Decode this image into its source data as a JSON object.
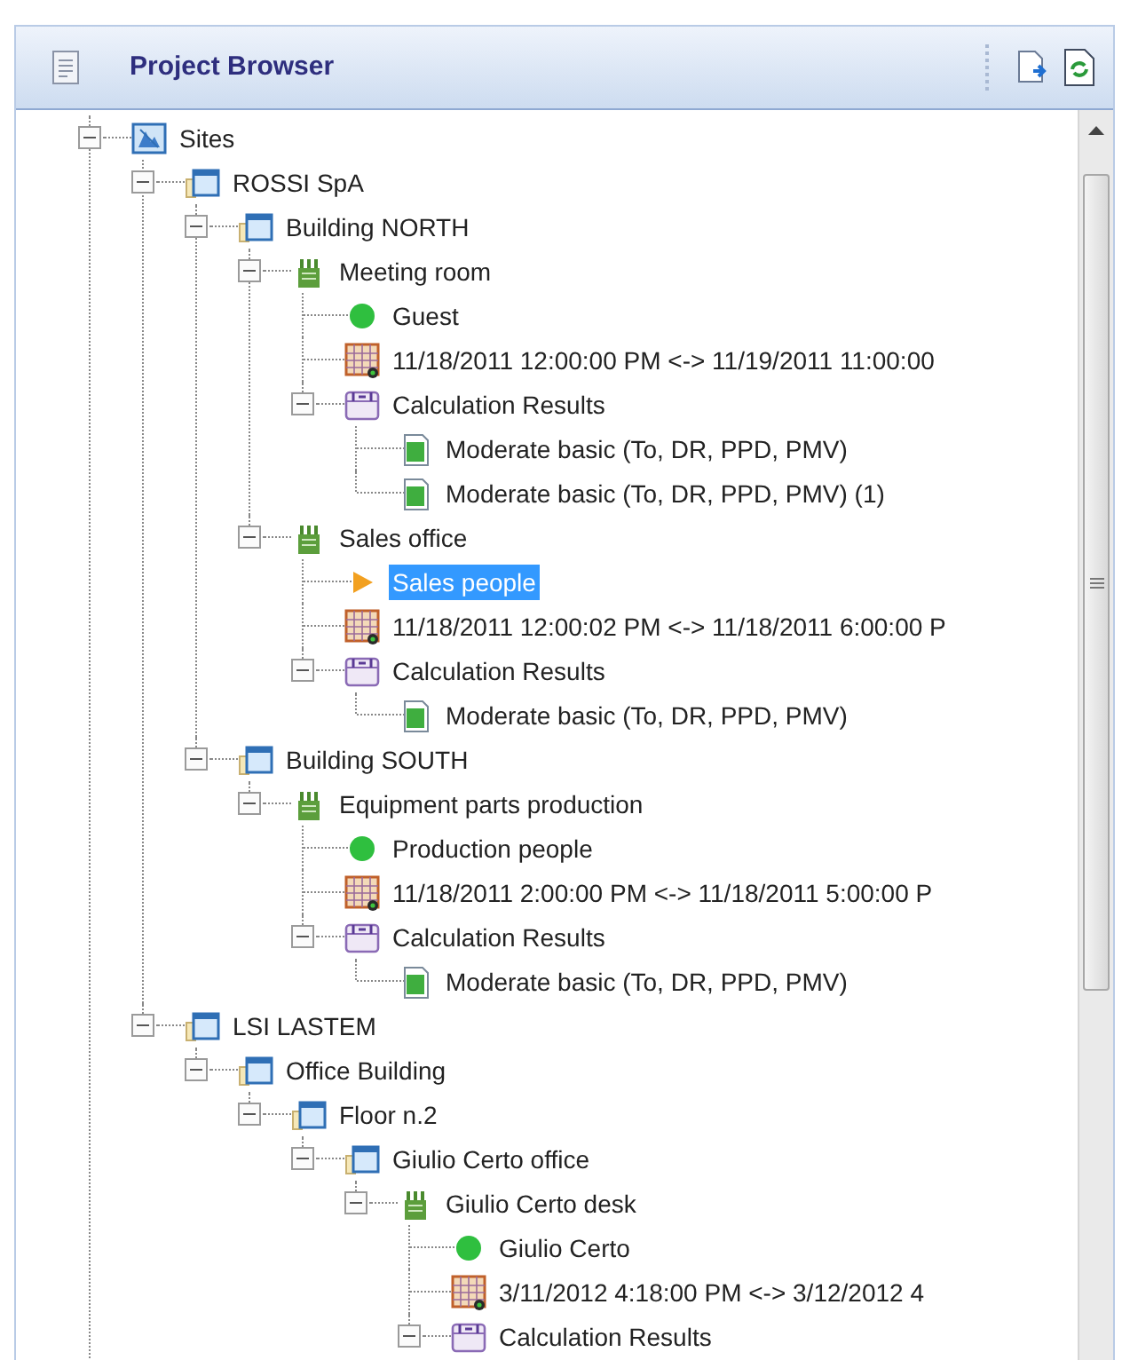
{
  "panel": {
    "title": "Project Browser"
  },
  "tree": [
    {
      "label": "Sites",
      "kind": "sites",
      "expanded": true,
      "selected": false,
      "children": [
        {
          "label": "ROSSI SpA",
          "kind": "site",
          "expanded": true,
          "selected": false,
          "children": [
            {
              "label": "Building NORTH",
              "kind": "site",
              "expanded": true,
              "selected": false,
              "children": [
                {
                  "label": "Meeting room",
                  "kind": "room",
                  "expanded": true,
                  "selected": false,
                  "children": [
                    {
                      "label": "Guest",
                      "kind": "occupant",
                      "selected": false
                    },
                    {
                      "label": "11/18/2011 12:00:00 PM <-> 11/19/2011 11:00:00",
                      "kind": "schedule",
                      "selected": false
                    },
                    {
                      "label": "Calculation Results",
                      "kind": "results",
                      "expanded": true,
                      "selected": false,
                      "children": [
                        {
                          "label": "Moderate basic (To, DR, PPD, PMV)",
                          "kind": "report",
                          "selected": false
                        },
                        {
                          "label": "Moderate basic (To, DR, PPD, PMV) (1)",
                          "kind": "report",
                          "selected": false
                        }
                      ]
                    }
                  ]
                },
                {
                  "label": "Sales office",
                  "kind": "room",
                  "expanded": true,
                  "selected": false,
                  "children": [
                    {
                      "label": "Sales people",
                      "kind": "occupant-active",
                      "selected": true
                    },
                    {
                      "label": "11/18/2011 12:00:02 PM <-> 11/18/2011 6:00:00 P",
                      "kind": "schedule",
                      "selected": false
                    },
                    {
                      "label": "Calculation Results",
                      "kind": "results",
                      "expanded": true,
                      "selected": false,
                      "children": [
                        {
                          "label": "Moderate basic (To, DR, PPD, PMV)",
                          "kind": "report",
                          "selected": false
                        }
                      ]
                    }
                  ]
                }
              ]
            },
            {
              "label": "Building SOUTH",
              "kind": "site",
              "expanded": true,
              "selected": false,
              "children": [
                {
                  "label": "Equipment parts production",
                  "kind": "room",
                  "expanded": true,
                  "selected": false,
                  "children": [
                    {
                      "label": "Production people",
                      "kind": "occupant",
                      "selected": false
                    },
                    {
                      "label": "11/18/2011 2:00:00 PM <-> 11/18/2011 5:00:00 P",
                      "kind": "schedule",
                      "selected": false
                    },
                    {
                      "label": "Calculation Results",
                      "kind": "results",
                      "expanded": true,
                      "selected": false,
                      "children": [
                        {
                          "label": "Moderate basic (To, DR, PPD, PMV)",
                          "kind": "report",
                          "selected": false
                        }
                      ]
                    }
                  ]
                }
              ]
            }
          ]
        },
        {
          "label": "LSI LASTEM",
          "kind": "site",
          "expanded": true,
          "selected": false,
          "children": [
            {
              "label": "Office Building",
              "kind": "site",
              "expanded": true,
              "selected": false,
              "children": [
                {
                  "label": "Floor n.2",
                  "kind": "site",
                  "expanded": true,
                  "selected": false,
                  "children": [
                    {
                      "label": "Giulio Certo office",
                      "kind": "site",
                      "expanded": true,
                      "selected": false,
                      "children": [
                        {
                          "label": "Giulio Certo desk",
                          "kind": "room",
                          "expanded": true,
                          "selected": false,
                          "children": [
                            {
                              "label": "Giulio Certo",
                              "kind": "occupant",
                              "selected": false
                            },
                            {
                              "label": "3/11/2012 4:18:00 PM <-> 3/12/2012 4",
                              "kind": "schedule",
                              "selected": false
                            },
                            {
                              "label": "Calculation Results",
                              "kind": "results",
                              "expanded": true,
                              "selected": false
                            }
                          ]
                        }
                      ]
                    }
                  ]
                }
              ]
            }
          ]
        }
      ]
    }
  ]
}
